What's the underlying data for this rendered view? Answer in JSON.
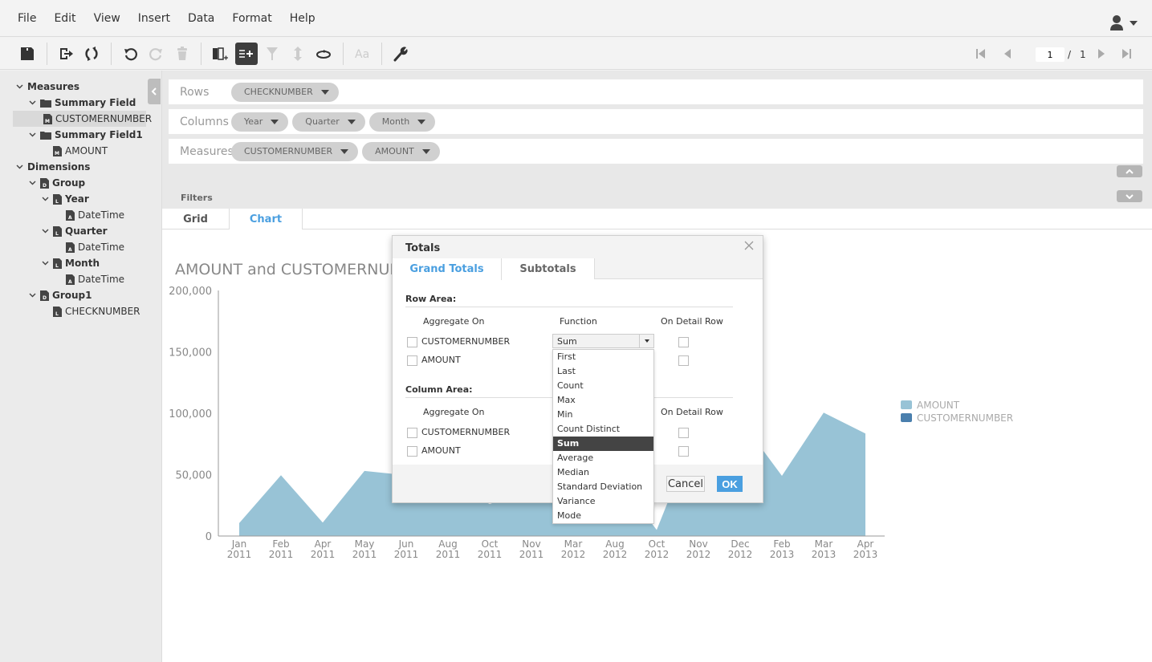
{
  "menubar": {
    "items": [
      "File",
      "Edit",
      "View",
      "Insert",
      "Data",
      "Format",
      "Help"
    ],
    "user_icon": "user-icon"
  },
  "toolbar": {
    "buttons": [
      "save-icon",
      "export-icon",
      "refresh-icon",
      "undo-icon",
      "redo-icon",
      "delete-icon",
      "add-column-icon",
      "add-row-icon",
      "filter-icon",
      "sort-icon",
      "swap-icon",
      "font-icon",
      "wrench-icon"
    ],
    "pager": {
      "current_page": "1",
      "separator": "/",
      "total_pages": "1"
    }
  },
  "sidebar": {
    "tree": [
      {
        "label": "Measures",
        "level": 0,
        "bold": true,
        "icon": "none",
        "expanded": true
      },
      {
        "label": "Summary Field",
        "level": 1,
        "bold": true,
        "icon": "folder",
        "expanded": true
      },
      {
        "label": "CUSTOMERNUMBER",
        "level": 2,
        "bold": false,
        "icon": "measure",
        "selected": true
      },
      {
        "label": "Summary Field1",
        "level": 1,
        "bold": true,
        "icon": "folder",
        "expanded": true
      },
      {
        "label": "AMOUNT",
        "level": 2,
        "bold": false,
        "icon": "measure"
      },
      {
        "label": "Dimensions",
        "level": 0,
        "bold": true,
        "icon": "none",
        "expanded": true
      },
      {
        "label": "Group",
        "level": 1,
        "bold": true,
        "icon": "dimension",
        "expanded": true
      },
      {
        "label": "Year",
        "level": 2,
        "bold": true,
        "icon": "level",
        "expanded": true
      },
      {
        "label": "DateTime",
        "level": 3,
        "bold": false,
        "icon": "attribute"
      },
      {
        "label": "Quarter",
        "level": 2,
        "bold": true,
        "icon": "level",
        "expanded": true
      },
      {
        "label": "DateTime",
        "level": 3,
        "bold": false,
        "icon": "attribute"
      },
      {
        "label": "Month",
        "level": 2,
        "bold": true,
        "icon": "level",
        "expanded": true
      },
      {
        "label": "DateTime",
        "level": 3,
        "bold": false,
        "icon": "attribute"
      },
      {
        "label": "Group1",
        "level": 1,
        "bold": true,
        "icon": "dimension",
        "expanded": true
      },
      {
        "label": "CHECKNUMBER",
        "level": 2,
        "bold": false,
        "icon": "level"
      }
    ]
  },
  "shelves": {
    "rows": {
      "label": "Rows",
      "pills": [
        "CHECKNUMBER"
      ]
    },
    "columns": {
      "label": "Columns",
      "pills": [
        "Year",
        "Quarter",
        "Month"
      ]
    },
    "measures": {
      "label": "Measures",
      "pills": [
        "CUSTOMERNUMBER",
        "AMOUNT"
      ]
    },
    "filters_label": "Filters"
  },
  "view_tabs": {
    "grid": "Grid",
    "chart": "Chart",
    "active": "Chart"
  },
  "chart_data": {
    "type": "area",
    "title": "AMOUNT and CUSTOMERNUMBER",
    "xlabel": "",
    "ylabel": "",
    "ylim": [
      0,
      200000
    ],
    "yticks": [
      "0",
      "50,000",
      "100,000",
      "150,000",
      "200,000"
    ],
    "ytick_values": [
      0,
      50000,
      100000,
      150000,
      200000
    ],
    "categories": [
      "Jan 2011",
      "Feb 2011",
      "Apr 2011",
      "May 2011",
      "Jun 2011",
      "Aug 2011",
      "Oct 2011",
      "Nov 2011",
      "Mar 2012",
      "Aug 2012",
      "Oct 2012",
      "Nov 2012",
      "Dec 2012",
      "Feb 2013",
      "Mar 2013",
      "Apr 2013"
    ],
    "category_months": [
      "Jan",
      "Feb",
      "Apr",
      "May",
      "Jun",
      "Aug",
      "Oct",
      "Nov",
      "Mar",
      "Aug",
      "Oct",
      "Nov",
      "Dec",
      "Feb",
      "Mar",
      "Apr"
    ],
    "category_years": [
      "2011",
      "2011",
      "2011",
      "2011",
      "2011",
      "2011",
      "2011",
      "2011",
      "2012",
      "2012",
      "2012",
      "2012",
      "2012",
      "2013",
      "2013",
      "2013"
    ],
    "series": [
      {
        "name": "AMOUNT",
        "color": "#98c3d6",
        "values": [
          10500,
          49500,
          11000,
          53000,
          49500,
          45000,
          26000,
          40000,
          45000,
          50000,
          5000,
          90000,
          95000,
          49000,
          100500,
          83500
        ]
      },
      {
        "name": "CUSTOMERNUMBER",
        "color": "#4a7fad",
        "values": []
      }
    ],
    "legend": "right",
    "grid": false
  },
  "dialog": {
    "title": "Totals",
    "tabs": [
      "Grand Totals",
      "Subtotals"
    ],
    "active_tab": "Grand Totals",
    "row_area": {
      "title": "Row Area:",
      "headers": [
        "Aggregate On",
        "Function",
        "On Detail Row"
      ],
      "fields": [
        {
          "name": "CUSTOMERNUMBER",
          "checked": false,
          "function": "Sum",
          "detail": false
        },
        {
          "name": "AMOUNT",
          "checked": false,
          "detail": false
        }
      ]
    },
    "column_area": {
      "title": "Column Area:",
      "headers": [
        "Aggregate On",
        "On Detail Row"
      ],
      "fields": [
        {
          "name": "CUSTOMERNUMBER",
          "checked": false,
          "detail": false
        },
        {
          "name": "AMOUNT",
          "checked": false,
          "detail": false
        }
      ]
    },
    "function_options": [
      "First",
      "Last",
      "Count",
      "Max",
      "Min",
      "Count Distinct",
      "Sum",
      "Average",
      "Median",
      "Standard Deviation",
      "Variance",
      "Mode"
    ],
    "selected_function": "Sum",
    "cancel_label": "Cancel",
    "ok_label": "OK"
  },
  "colors": {
    "accent": "#4a9fe0",
    "amount": "#98c3d6",
    "customernumber": "#4a7fad"
  }
}
